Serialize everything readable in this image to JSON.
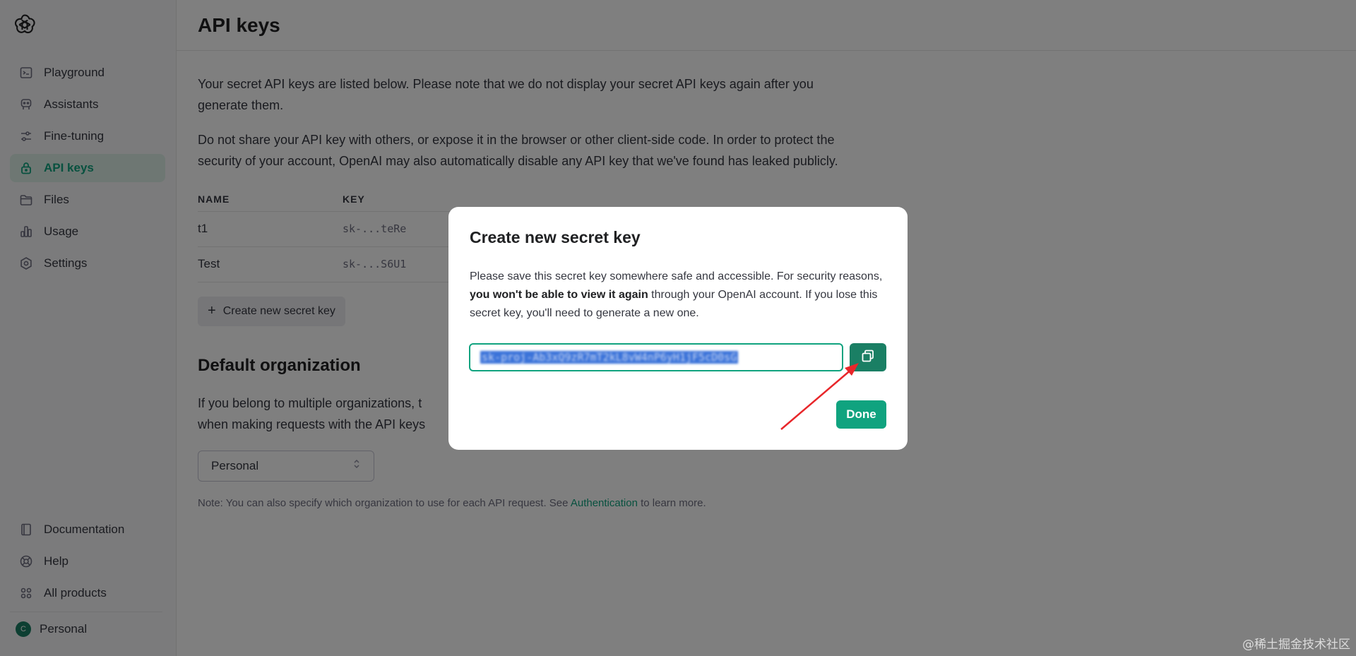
{
  "sidebar": {
    "logo_icon": "openai-logo-icon",
    "items": [
      {
        "label": "Playground",
        "icon": "terminal-icon"
      },
      {
        "label": "Assistants",
        "icon": "robot-icon"
      },
      {
        "label": "Fine-tuning",
        "icon": "sliders-icon"
      },
      {
        "label": "API keys",
        "icon": "lock-icon",
        "active": true
      },
      {
        "label": "Files",
        "icon": "folder-icon"
      },
      {
        "label": "Usage",
        "icon": "chart-icon"
      },
      {
        "label": "Settings",
        "icon": "gear-icon"
      }
    ],
    "bottom_items": [
      {
        "label": "Documentation",
        "icon": "book-icon"
      },
      {
        "label": "Help",
        "icon": "help-ring-icon"
      },
      {
        "label": "All products",
        "icon": "grid-icon"
      }
    ],
    "org": {
      "avatar_letter": "C",
      "label": "Personal"
    }
  },
  "main": {
    "title": "API keys",
    "intro_1": "Your secret API keys are listed below. Please note that we do not display your secret API keys again after you generate them.",
    "intro_2": "Do not share your API key with others, or expose it in the browser or other client-side code. In order to protect the security of your account, OpenAI may also automatically disable any API key that we've found has leaked publicly.",
    "table": {
      "headers": [
        "NAME",
        "KEY"
      ],
      "rows": [
        {
          "name": "t1",
          "key": "sk-...teRe"
        },
        {
          "name": "Test",
          "key": "sk-...S6U1"
        }
      ]
    },
    "create_button": "Create new secret key",
    "default_org": {
      "title": "Default organization",
      "text_line_1": "If you belong to multiple organizations, t",
      "text_line_2": "when making requests with the API keys",
      "select_value": "Personal",
      "note_prefix": "Note: You can also specify which organization to use for each API request. See ",
      "note_link": "Authentication",
      "note_suffix": " to learn more."
    }
  },
  "modal": {
    "title": "Create new secret key",
    "text_before": "Please save this secret key somewhere safe and accessible. For security reasons, ",
    "text_bold": "you won't be able to view it again",
    "text_after": " through your OpenAI account. If you lose this secret key, you'll need to generate a new one.",
    "key_value": "sk-proj-Ab3xQ9zR7mT2kL8vW4nP6yH1jF5cD0sG",
    "copy_icon": "copy-icon",
    "done_button": "Done",
    "annotation_color": "#e8262a"
  },
  "watermark": "@稀土掘金技术社区",
  "colors": {
    "accent": "#10a37f",
    "accent_dark": "#1a7f64"
  }
}
